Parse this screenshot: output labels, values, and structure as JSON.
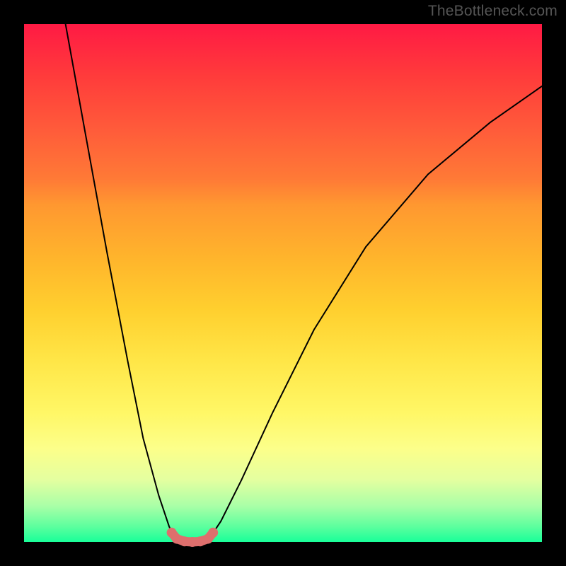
{
  "watermark": "TheBottleneck.com",
  "chart_data": {
    "type": "line",
    "title": "",
    "xlabel": "",
    "ylabel": "",
    "xlim": [
      0,
      100
    ],
    "ylim": [
      0,
      100
    ],
    "grid": false,
    "legend": false,
    "series": [
      {
        "name": "left-branch",
        "x": [
          8,
          12,
          16,
          20,
          23,
          26,
          28,
          29,
          29.8
        ],
        "y": [
          100,
          78,
          56,
          35,
          20,
          9,
          3,
          0.8,
          0.2
        ],
        "color": "#000000"
      },
      {
        "name": "right-branch",
        "x": [
          35.2,
          36,
          38,
          42,
          48,
          56,
          66,
          78,
          90,
          100
        ],
        "y": [
          0.2,
          1,
          4,
          12,
          25,
          41,
          57,
          71,
          81,
          88
        ],
        "color": "#000000"
      }
    ],
    "markers": {
      "name": "valley-dots",
      "color": "#de6f6d",
      "points": [
        {
          "x": 28.5,
          "y": 1.8
        },
        {
          "x": 29.5,
          "y": 0.6
        },
        {
          "x": 31.0,
          "y": 0.1
        },
        {
          "x": 32.5,
          "y": 0.0
        },
        {
          "x": 34.0,
          "y": 0.1
        },
        {
          "x": 35.5,
          "y": 0.6
        },
        {
          "x": 36.5,
          "y": 1.8
        }
      ]
    },
    "annotations": []
  }
}
